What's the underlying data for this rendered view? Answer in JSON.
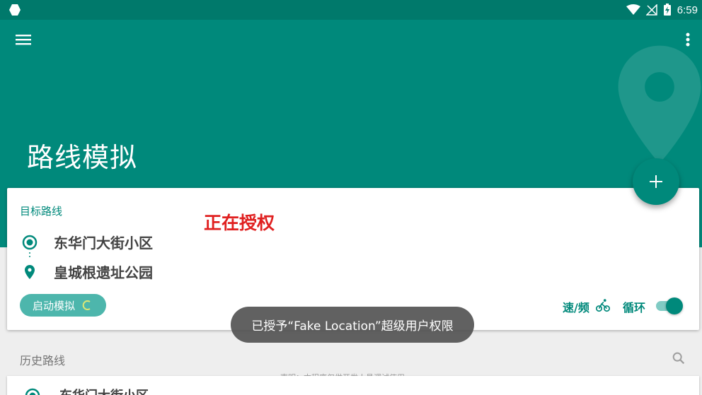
{
  "status_bar": {
    "time": "6:59",
    "icons": [
      "app-notification-icon",
      "wifi-icon",
      "no-signal-icon",
      "battery-charging-icon"
    ]
  },
  "app_bar": {
    "title": "路线模拟",
    "color": "#00897b",
    "status_color": "#00796b"
  },
  "target_route": {
    "label": "目标路线",
    "authorizing_text": "正在授权",
    "start": "东华门大街小区",
    "end": "皇城根遗址公园",
    "start_button": "启动模拟",
    "speed_label": "速/频",
    "loop_label": "循环",
    "loop_enabled": true
  },
  "history": {
    "label": "历史路线",
    "disclaimer": "声明：本程序仅供开发人员调试使用",
    "items": [
      {
        "name": "东华门大街小区"
      }
    ]
  },
  "toast": {
    "text": "已授予“Fake Location”超级用户权限"
  },
  "colors": {
    "accent": "#00897b",
    "light_accent": "#4db6ac",
    "warning": "#e02020"
  }
}
